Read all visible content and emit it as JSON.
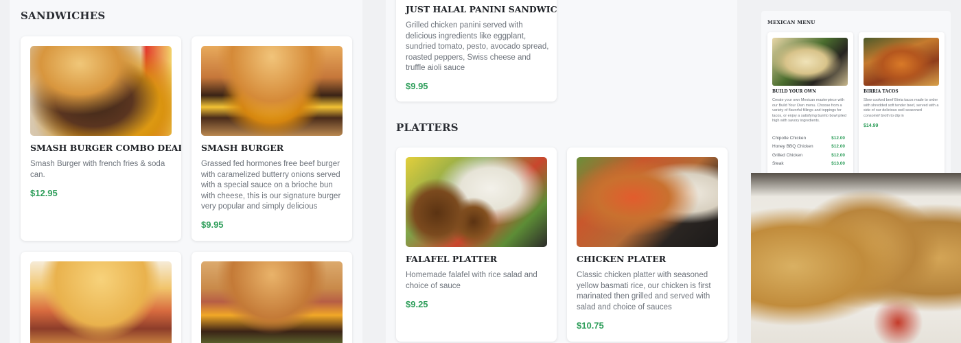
{
  "sandwiches": {
    "heading": "SANDWICHES",
    "items": [
      {
        "title": "SMASH BURGER COMBO DEAL",
        "description": "Smash Burger with french fries & soda can.",
        "price": "$12.95",
        "image_alt": "smash burger with fries"
      },
      {
        "title": "SMASH BURGER",
        "description": "Grassed fed hormones free beef burger with caramelized butterry onions served with a special sauce on a brioche bun with cheese, this is our signature burger very popular and simply delicious",
        "price": "$9.95",
        "image_alt": "smash burger"
      },
      {
        "image_alt": "fried chicken sandwich"
      },
      {
        "image_alt": "double cheeseburger"
      }
    ]
  },
  "panini": {
    "title": "JUST HALAL PANINI SANDWICH",
    "description": "Grilled chicken panini served with delicious ingredients like eggplant, sundried tomato, pesto, avocado spread, roasted peppers, Swiss cheese and truffle aioli sauce",
    "price": "$9.95"
  },
  "platters": {
    "heading": "PLATTERS",
    "items": [
      {
        "title": "FALAFEL PLATTER",
        "description": "Homemade falafel with rice salad and choice of sauce",
        "price": "$9.25",
        "image_alt": "falafel platter"
      },
      {
        "title": "CHICKEN PLATER",
        "description": "Classic chicken platter with seasoned yellow basmati rice, our chicken is first marinated then grilled and served with salad and choice of sauces",
        "price": "$10.75",
        "image_alt": "chicken platter"
      }
    ]
  },
  "mexican_menu": {
    "heading": "MEXICAN MENU",
    "build": {
      "title": "BUILD YOUR OWN",
      "description": "Create your own Mexican masterpiece with our Build Your Own menu. Choose from a variety of flavorful fillings and toppings for tacos, or enjoy a satisfying burrito bowl piled high with savory ingredients.",
      "options": [
        {
          "name": "Chipotle Chicken",
          "price": "$12.00"
        },
        {
          "name": "Honey BBQ Chicken",
          "price": "$12.00"
        },
        {
          "name": "Grilled Chicken",
          "price": "$12.00"
        },
        {
          "name": "Steak",
          "price": "$13.00"
        }
      ]
    },
    "birria": {
      "title": "BIRRIA TACOS",
      "description": "Slow cooked beef Birria tacos made to order with shredded soft tender beef, served with a side of our delicious well seasoned consomé/ broth to dip in",
      "price": "$14.99"
    }
  },
  "photo": {
    "image_alt": "tacos in takeout container"
  },
  "colors": {
    "price": "#2f9e5b",
    "title": "#1f2227",
    "description": "#6d737b",
    "background": "#f7f8fa"
  }
}
